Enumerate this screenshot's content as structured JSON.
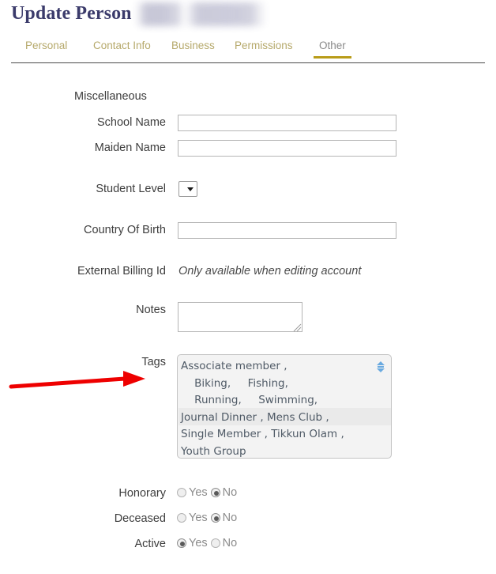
{
  "header": {
    "title": "Update Person",
    "redacted_name_present": true
  },
  "tabs": [
    {
      "label": "Personal",
      "active": false
    },
    {
      "label": "Contact Info",
      "active": false
    },
    {
      "label": "Business",
      "active": false
    },
    {
      "label": "Permissions",
      "active": false
    },
    {
      "label": "Other",
      "active": true
    }
  ],
  "form": {
    "section_heading": "Miscellaneous",
    "school_name": {
      "label": "School Name",
      "value": "",
      "placeholder": ""
    },
    "maiden_name": {
      "label": "Maiden Name",
      "value": "",
      "placeholder": ""
    },
    "student_level": {
      "label": "Student Level",
      "value": "",
      "options": [
        ""
      ]
    },
    "country_of_birth": {
      "label": "Country Of Birth",
      "value": "",
      "placeholder": ""
    },
    "external_billing_id": {
      "label": "External Billing Id",
      "note": "Only available when editing account"
    },
    "notes": {
      "label": "Notes",
      "value": "",
      "placeholder": ""
    },
    "tags": {
      "label": "Tags",
      "value": "Associate member ,\n    Biking,     Fishing,\n    Running,     Swimming,\nJournal Dinner , Mens Club ,\nSingle Member , Tikkun Olam ,\nYouth Group",
      "items": [
        "Associate member",
        "Biking",
        "Fishing",
        "Running",
        "Swimming",
        "Journal Dinner",
        "Mens Club",
        "Single Member",
        "Tikkun Olam",
        "Youth Group"
      ],
      "scroll_icon": "up-down-arrow-icon"
    }
  },
  "radios": {
    "yes_label": "Yes",
    "no_label": "No",
    "rows": [
      {
        "label": "Honorary",
        "selected": "No"
      },
      {
        "label": "Deceased",
        "selected": "No"
      },
      {
        "label": "Active",
        "selected": "Yes"
      }
    ]
  },
  "annotation": {
    "arrow_color": "#ee0000",
    "points_to": "Tags"
  },
  "colors": {
    "title": "#3b3b6b",
    "tab_inactive": "#b6a96b",
    "tab_active_underline": "#b99c19",
    "tags_text": "#4f5a66",
    "tags_background": "#f3f3f3",
    "annotation_red": "#ee0000"
  }
}
